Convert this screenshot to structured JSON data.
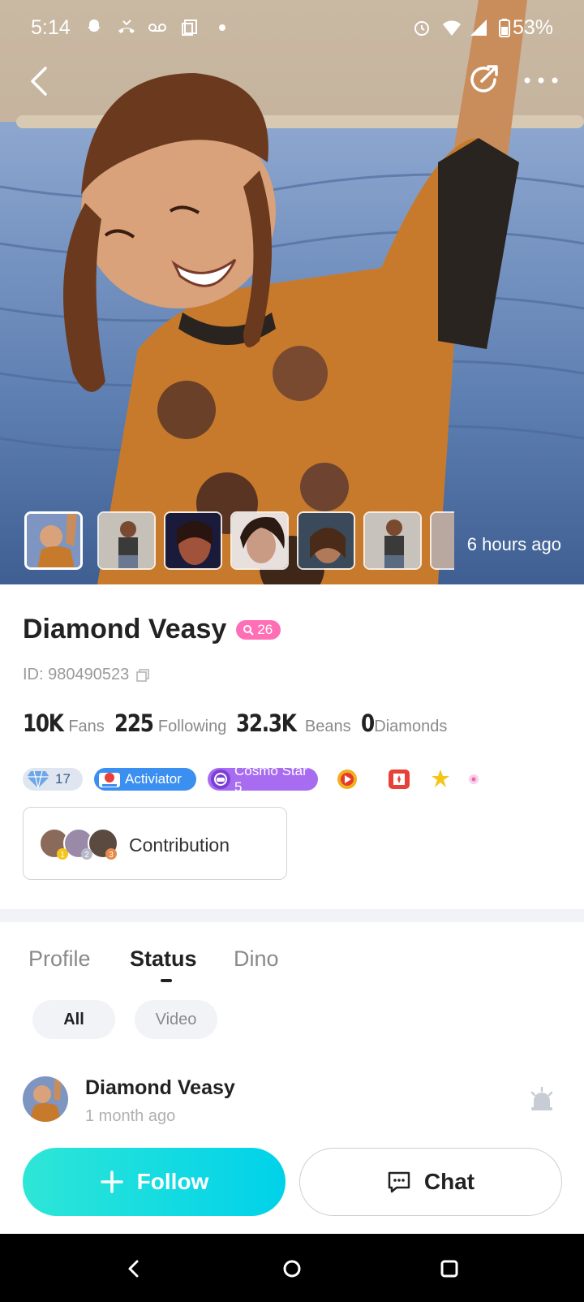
{
  "status_bar": {
    "time": "5:14",
    "battery": "53%"
  },
  "hero": {
    "time_ago": "6 hours ago",
    "thumbnail_count": 7
  },
  "profile": {
    "name": "Diamond Veasy",
    "level": "26",
    "id_text": "ID: 980490523",
    "stats": [
      {
        "value": "10K",
        "label": "Fans"
      },
      {
        "value": "225",
        "label": "Following"
      },
      {
        "value": "32.3K",
        "label": "Beans"
      },
      {
        "value": "0",
        "label": "Diamonds"
      }
    ],
    "badges": {
      "diamond_level": "17",
      "activator": "Activiator",
      "cosmo": "Cosmo Star 5"
    },
    "contribution_label": "Contribution"
  },
  "tabs": [
    {
      "label": "Profile"
    },
    {
      "label": "Status"
    },
    {
      "label": "Dino"
    }
  ],
  "filters": {
    "all": "All",
    "video": "Video"
  },
  "post": {
    "author": "Diamond Veasy",
    "time": "1 month ago"
  },
  "actions": {
    "follow": "Follow",
    "chat": "Chat"
  },
  "colors": {
    "follow_start": "#2ee6d6",
    "follow_end": "#00d2ea",
    "level_badge": "#ff6fb6",
    "activator_badge": "#3b8ff0",
    "cosmo_badge": "#a86cf0"
  }
}
